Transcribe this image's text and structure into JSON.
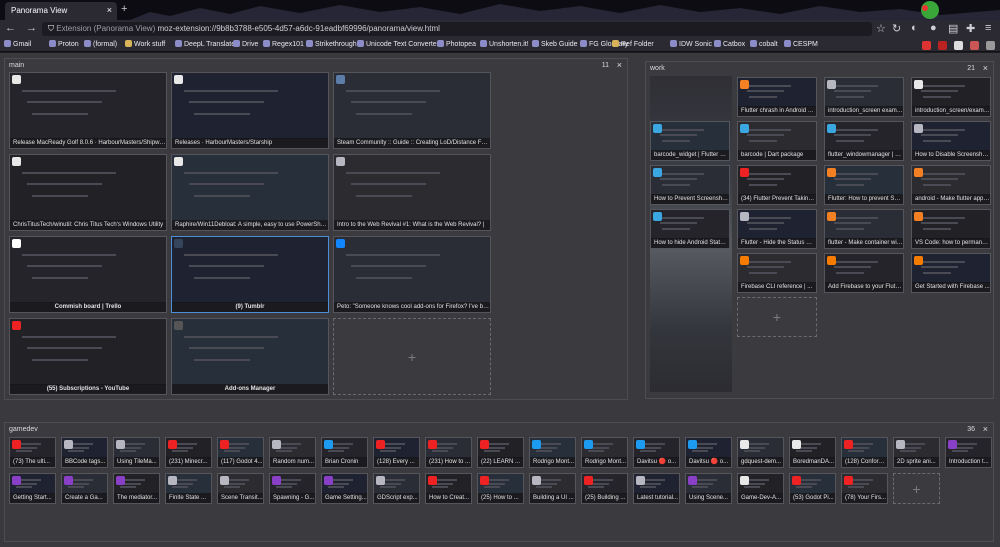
{
  "browser": {
    "tab_title": "Panorama View",
    "url_prefix": "Extension (Panorama View)",
    "url_scheme": "moz-extension://",
    "url_path": "9b8b3788-e505-4d57-a6dc-91eadbf69996/panorama/view.html"
  },
  "bookmarks": [
    "Gmail",
    "Proton",
    "(formal)",
    "Work stuff",
    "DeepL Translate",
    "Drive",
    "Regex101",
    "Strikethrough",
    "Unicode Text Converter",
    "Photopea",
    "Unshorten.it!",
    "Skeb Guide",
    "FG Glossary",
    "Ref Folder",
    "IDW Sonic",
    "Catbox",
    "cobalt",
    "CESPM"
  ],
  "colors": {
    "accent": "#4a8fd8",
    "youtube": "#e22",
    "github": "#eee",
    "twitter": "#1d9bf0",
    "godot": "#478cbf",
    "flutter": "#54c5f8",
    "firebase": "#ffca28"
  },
  "groups": {
    "main": {
      "name": "main",
      "count": "11",
      "tabs": [
        {
          "title": "Release MacReady Golf 8.0.6 · HarbourMasters/Shipwright",
          "icon": "github-icon"
        },
        {
          "title": "Releases · HarbourMasters/Starship",
          "icon": "github-icon"
        },
        {
          "title": "Steam Community :: Guide :: Creating LoD/Distance Fade",
          "icon": "steam-icon"
        },
        {
          "title": "ChrisTitusTech/winutil: Chris Titus Tech's Windows Utility",
          "icon": "github-icon"
        },
        {
          "title": "Raphire/Win11Debloat: A simple, easy to use PowerShell script",
          "icon": "github-icon"
        },
        {
          "title": "Intro to the Web Revival #1: What is the Web Revival? |",
          "icon": "page-icon"
        },
        {
          "title": "Commish board | Trello",
          "icon": "trello-icon"
        },
        {
          "title": "(9) Tumblr",
          "icon": "tumblr-icon"
        },
        {
          "title": "Peto: \"Someone knows cool add-ons for Firefox? I've been",
          "icon": "bluesky-icon"
        },
        {
          "title": "(55) Subscriptions - YouTube",
          "icon": "youtube-icon"
        },
        {
          "title": "Add-ons Manager",
          "icon": "puzzle-icon"
        }
      ]
    },
    "work": {
      "name": "work",
      "count": "21",
      "tabs": [
        {
          "title": "",
          "icon": ""
        },
        {
          "title": "Flutter chrash in Android 1...",
          "icon": "stackoverflow-icon"
        },
        {
          "title": "introduction_screen examp...",
          "icon": "page-icon"
        },
        {
          "title": "introduction_screen/examp...",
          "icon": "github-icon"
        },
        {
          "title": "barcode_widget | Flutter pa...",
          "icon": "flutter-icon"
        },
        {
          "title": "barcode | Dart package",
          "icon": "flutter-icon"
        },
        {
          "title": "flutter_windowmanager | Fl...",
          "icon": "flutter-icon"
        },
        {
          "title": "How to Disable Screenshot...",
          "icon": "page-icon"
        },
        {
          "title": "How to Prevent Screenshot...",
          "icon": "flutter-icon"
        },
        {
          "title": "(34) Flutter Prevent Taking ...",
          "icon": "youtube-icon"
        },
        {
          "title": "Flutter: How to prevent Scr...",
          "icon": "stackoverflow-icon"
        },
        {
          "title": "android - Make flutter appli...",
          "icon": "stackoverflow-icon"
        },
        {
          "title": "How to hide Android Status ...",
          "icon": "flutter-icon"
        },
        {
          "title": "Flutter - Hide the Status Ba...",
          "icon": "page-icon"
        },
        {
          "title": "flutter - Make container wid...",
          "icon": "stackoverflow-icon"
        },
        {
          "title": "VS Code: how to permane...",
          "icon": "stackoverflow-icon"
        },
        {
          "title": "",
          "icon": ""
        },
        {
          "title": "Firebase CLI reference  |  ...",
          "icon": "firebase-icon"
        },
        {
          "title": "Add Firebase to your Flutter...",
          "icon": "firebase-icon"
        },
        {
          "title": "Get Started with Firebase ...",
          "icon": "firebase-icon"
        },
        {
          "title": "",
          "icon": ""
        }
      ]
    },
    "gamedev": {
      "name": "gamedev",
      "count": "36",
      "tabs": [
        {
          "title": "(73) The ulti...",
          "icon": "youtube-icon"
        },
        {
          "title": "BBCode tags...",
          "icon": "page-icon"
        },
        {
          "title": "Using TileMa...",
          "icon": "page-icon"
        },
        {
          "title": "(231) Minecr...",
          "icon": "youtube-icon"
        },
        {
          "title": "(117) Godot 4...",
          "icon": "youtube-icon"
        },
        {
          "title": "Random num...",
          "icon": "page-icon"
        },
        {
          "title": "Brian Cronin",
          "icon": "twitter-icon"
        },
        {
          "title": "(128) Every ...",
          "icon": "youtube-icon"
        },
        {
          "title": "(231) How to ...",
          "icon": "youtube-icon"
        },
        {
          "title": "(22) LEARN ...",
          "icon": "youtube-icon"
        },
        {
          "title": "Rodrigo Mont...",
          "icon": "twitter-icon"
        },
        {
          "title": "Rodrigo Mont...",
          "icon": "twitter-icon"
        },
        {
          "title": "Davitsu 🔴 o...",
          "icon": "twitter-icon"
        },
        {
          "title": "Davitsu 🔴 o...",
          "icon": "twitter-icon"
        },
        {
          "title": "gdquest-dem...",
          "icon": "github-icon"
        },
        {
          "title": "BoredmanDA...",
          "icon": "github-icon"
        },
        {
          "title": "(128) Conform...",
          "icon": "youtube-icon"
        },
        {
          "title": "2D sprite ani...",
          "icon": "page-icon"
        },
        {
          "title": "Introduction t...",
          "icon": "godot-icon"
        },
        {
          "title": "Getting Start...",
          "icon": "godot-icon"
        },
        {
          "title": "Create a Ga...",
          "icon": "godot-icon"
        },
        {
          "title": "The mediator...",
          "icon": "godot-icon"
        },
        {
          "title": "Finite State ...",
          "icon": "page-icon"
        },
        {
          "title": "Scene Transit...",
          "icon": "page-icon"
        },
        {
          "title": "Spawning - G...",
          "icon": "godot-icon"
        },
        {
          "title": "Game Setting...",
          "icon": "godot-icon"
        },
        {
          "title": "GDScript exp...",
          "icon": "page-icon"
        },
        {
          "title": "How to Creat...",
          "icon": "youtube-icon"
        },
        {
          "title": "(25) How to ...",
          "icon": "youtube-icon"
        },
        {
          "title": "Building a UI ...",
          "icon": "page-icon"
        },
        {
          "title": "(25) Building ...",
          "icon": "youtube-icon"
        },
        {
          "title": "Latest tutorial...",
          "icon": "page-icon"
        },
        {
          "title": "Using Scene...",
          "icon": "godot-icon"
        },
        {
          "title": "Game-Dev-A...",
          "icon": "github-icon"
        },
        {
          "title": "(53) Godot Pi...",
          "icon": "youtube-icon"
        },
        {
          "title": "(78) Your Firs...",
          "icon": "youtube-icon"
        }
      ]
    }
  },
  "new_tab_symbol": "+",
  "close_symbol": "×"
}
